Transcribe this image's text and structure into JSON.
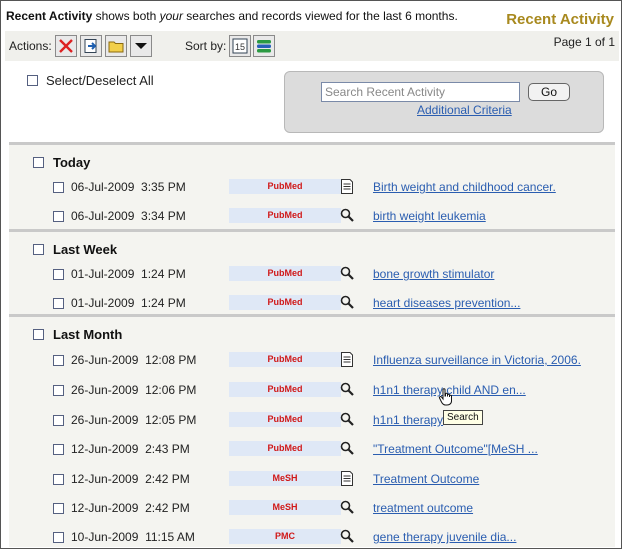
{
  "header": {
    "desc_strong": "Recent Activity",
    "desc_mid": " shows both ",
    "desc_em": "your",
    "desc_end": " searches and records viewed for the last 6 months.",
    "title": "Recent Activity"
  },
  "toolbar": {
    "actions_label": "Actions:",
    "sort_label": "Sort by:",
    "page_text": "Page 1 of 1",
    "buttons": [
      "delete-icon",
      "send-to-icon",
      "folder-icon",
      "menu-arrow-icon"
    ],
    "sort_buttons": [
      "sort-by-time-icon",
      "sort-by-type-icon"
    ]
  },
  "select_all": {
    "label": "Select/Deselect All"
  },
  "search": {
    "placeholder": "Search Recent Activity",
    "go_label": "Go",
    "additional_criteria": "Additional Criteria"
  },
  "sections": [
    {
      "title": "Today",
      "rows": [
        {
          "date": "06-Jul-2009",
          "time": "3:35 PM",
          "db": "PubMed",
          "icon": "document-icon",
          "link": "Birth weight and childhood cancer."
        },
        {
          "date": "06-Jul-2009",
          "time": "3:34 PM",
          "db": "PubMed",
          "icon": "magnifier-icon",
          "link": "birth weight leukemia"
        }
      ]
    },
    {
      "title": "Last Week",
      "rows": [
        {
          "date": "01-Jul-2009",
          "time": "1:24 PM",
          "db": "PubMed",
          "icon": "magnifier-icon",
          "link": "bone growth stimulator"
        },
        {
          "date": "01-Jul-2009",
          "time": "1:24 PM",
          "db": "PubMed",
          "icon": "magnifier-icon",
          "link": "heart diseases prevention..."
        }
      ]
    },
    {
      "title": "Last Month",
      "rows": [
        {
          "date": "26-Jun-2009",
          "time": "12:08 PM",
          "db": "PubMed",
          "icon": "document-icon",
          "link": "Influenza surveillance in Victoria, 2006."
        },
        {
          "date": "26-Jun-2009",
          "time": "12:06 PM",
          "db": "PubMed",
          "icon": "magnifier-icon",
          "link": "h1n1 therapy child AND en..."
        },
        {
          "date": "26-Jun-2009",
          "time": "12:05 PM",
          "db": "PubMed",
          "icon": "magnifier-icon",
          "link": "h1n1 therapy"
        },
        {
          "date": "12-Jun-2009",
          "time": "2:43 PM",
          "db": "PubMed",
          "icon": "magnifier-icon",
          "link": "\"Treatment Outcome\"[MeSH ..."
        },
        {
          "date": "12-Jun-2009",
          "time": "2:42 PM",
          "db": "MeSH",
          "icon": "document-icon",
          "link": "Treatment Outcome"
        },
        {
          "date": "12-Jun-2009",
          "time": "2:42 PM",
          "db": "MeSH",
          "icon": "magnifier-icon",
          "link": "treatment outcome"
        },
        {
          "date": "10-Jun-2009",
          "time": "11:15 AM",
          "db": "PMC",
          "icon": "magnifier-icon",
          "link": "gene therapy juvenile dia..."
        }
      ]
    }
  ],
  "tooltip": {
    "text": "Search"
  },
  "colors": {
    "accent_title": "#a8891e",
    "link": "#2a5db0",
    "db_text": "#d01818",
    "db_bg": "#dfe8f6"
  }
}
